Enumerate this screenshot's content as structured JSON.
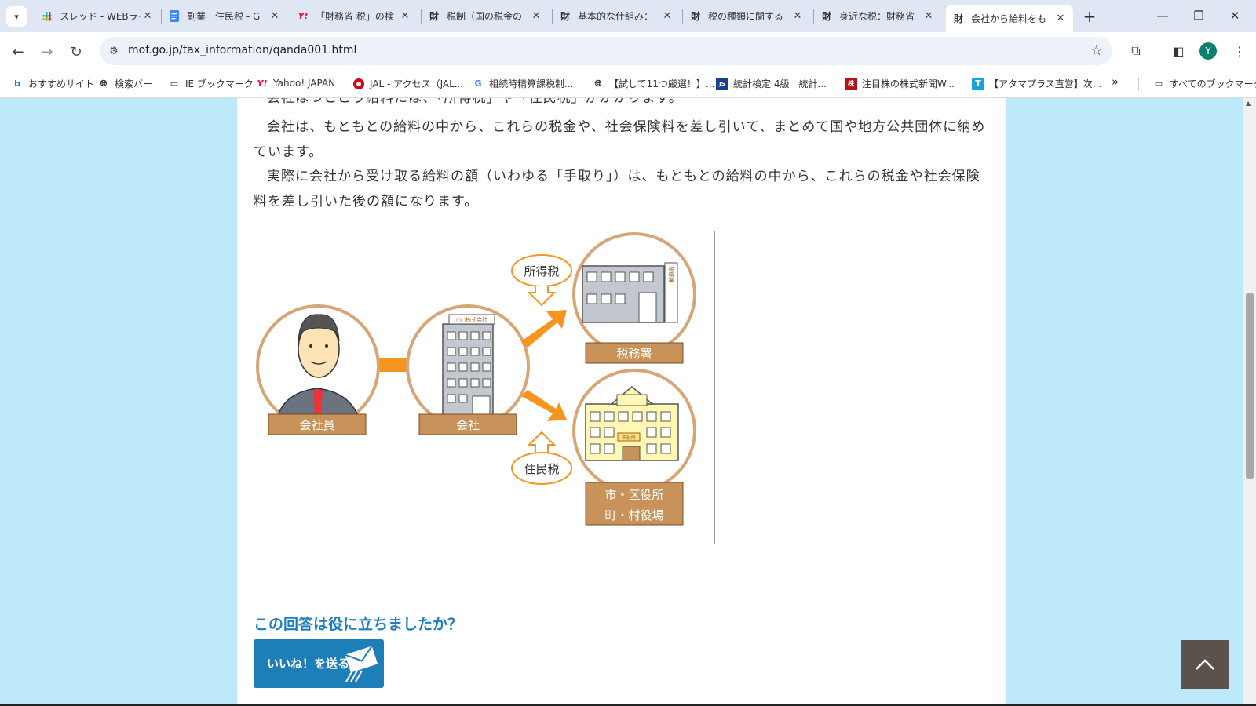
{
  "tabs": [
    {
      "title": "スレッド - WEBライ",
      "icon": "slack-icon",
      "color": "#e01e5a"
    },
    {
      "title": "副業　住民税 - G",
      "icon": "docs-icon",
      "color": "#4285f4"
    },
    {
      "title": "「財務省 税」の検",
      "icon": "yahoo-icon",
      "color": "#ff0033"
    },
    {
      "title": "税制（国の税金の",
      "icon": "mof-icon",
      "color": "#222"
    },
    {
      "title": "基本的な仕組み：",
      "icon": "mof-icon",
      "color": "#222"
    },
    {
      "title": "税の種類に関する",
      "icon": "mof-icon",
      "color": "#222"
    },
    {
      "title": "身近な税：財務省",
      "icon": "mof-icon",
      "color": "#222"
    },
    {
      "title": "会社から給料をも",
      "icon": "mof-icon",
      "color": "#222"
    }
  ],
  "mof_glyph": "財",
  "url": "mof.go.jp/tax_information/qanda001.html",
  "profile_initial": "Y",
  "bookmarks": [
    {
      "label": "おすすめサイト",
      "icon": "bing-icon"
    },
    {
      "label": "検索バー",
      "icon": "globe-icon"
    },
    {
      "label": "IE ブックマーク",
      "icon": "folder-icon"
    },
    {
      "label": "Yahoo! JAPAN",
      "icon": "yahoo-icon"
    },
    {
      "label": "JAL - アクセス（JAL...",
      "icon": "jal-icon"
    },
    {
      "label": "相続時精算課税制...",
      "icon": "google-icon"
    },
    {
      "label": "【試して11つ厳選！】...",
      "icon": "globe-icon"
    },
    {
      "label": "統計検定 4級｜統計...",
      "icon": "jssc-icon"
    },
    {
      "label": "注目株の株式新聞W...",
      "icon": "kabushiki-icon"
    },
    {
      "label": "【アタマプラス直営】次...",
      "icon": "t-icon"
    }
  ],
  "all_bookmarks": "すべてのブックマーク",
  "content": {
    "partial_line": "会社はつとこう給料には、「所得税」や「住民税」がかかります。",
    "para1": "会社は、もともとの給料の中から、これらの税金や、社会保険料を差し引いて、まとめて国や地方公共団体に納めています。",
    "para2": "実際に会社から受け取る給料の額（いわゆる「手取り」）は、もともとの給料の中から、これらの税金や社会保険料を差し引いた後の額になります。"
  },
  "figure": {
    "employee": "会社員",
    "company": "会社",
    "company_sign": "○○株式会社",
    "income_tax": "所得税",
    "tax_office": "税務署",
    "tax_office_sign": "税務署",
    "resident_tax": "住民税",
    "city_office_line1": "市・区役所",
    "city_office_line2": "町・村役場",
    "city_sign": "市役所"
  },
  "feedback": {
    "question": "この回答は役に立ちましたか？",
    "like_button": "いいね！を送る"
  },
  "colors": {
    "page_bg": "#bde9fb",
    "accent_blue": "#1e7fc0",
    "label_brown": "#c8935a",
    "arrow_orange": "#f7941d"
  }
}
